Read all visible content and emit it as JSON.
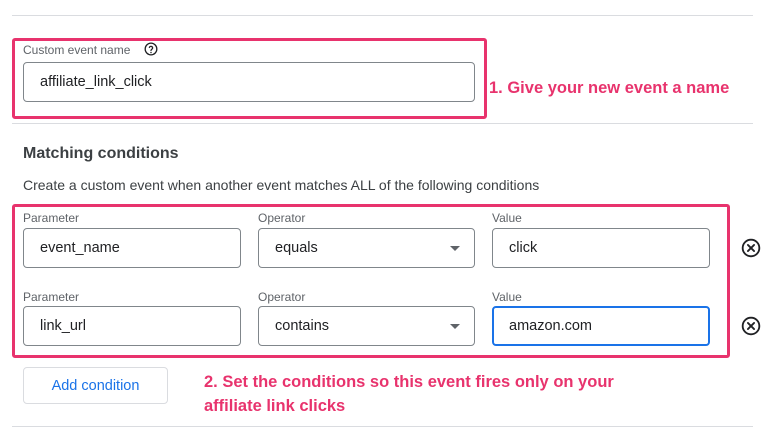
{
  "custom_event": {
    "label": "Custom event name",
    "value": "affiliate_link_click",
    "help_icon": "help-circle-icon"
  },
  "annotations": {
    "step1": "1. Give your new event a name",
    "step2": "2. Set the conditions so this event fires only on your affiliate link clicks"
  },
  "matching": {
    "title": "Matching conditions",
    "description": "Create a custom event when another event matches ALL of the following conditions",
    "column_labels": {
      "parameter": "Parameter",
      "operator": "Operator",
      "value": "Value"
    },
    "rows": [
      {
        "parameter": "event_name",
        "operator": "equals",
        "value": "click"
      },
      {
        "parameter": "link_url",
        "operator": "contains",
        "value": "amazon.com"
      }
    ],
    "remove_icon": "close-circle-icon",
    "add_condition_label": "Add condition"
  },
  "colors": {
    "highlight": "#e8336d",
    "accent": "#1a73e8"
  }
}
